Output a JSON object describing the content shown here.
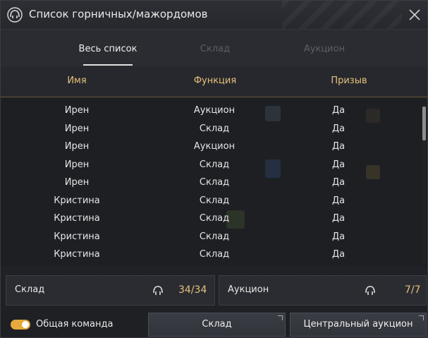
{
  "window": {
    "title": "Список горничных/мажордомов"
  },
  "tabs": [
    {
      "label": "Весь список",
      "active": true
    },
    {
      "label": "Склад",
      "active": false
    },
    {
      "label": "Аукцион",
      "active": false
    }
  ],
  "columns": {
    "name": "Имя",
    "function": "Функция",
    "summon": "Призыв"
  },
  "rows": [
    {
      "name": "Ирен",
      "function": "Аукцион",
      "summon": "Да"
    },
    {
      "name": "Ирен",
      "function": "Склад",
      "summon": "Да"
    },
    {
      "name": "Ирен",
      "function": "Аукцион",
      "summon": "Да"
    },
    {
      "name": "Ирен",
      "function": "Склад",
      "summon": "Да"
    },
    {
      "name": "Ирен",
      "function": "Склад",
      "summon": "Да"
    },
    {
      "name": "Кристина",
      "function": "Склад",
      "summon": "Да"
    },
    {
      "name": "Кристина",
      "function": "Склад",
      "summon": "Да"
    },
    {
      "name": "Кристина",
      "function": "Склад",
      "summon": "Да"
    },
    {
      "name": "Кристина",
      "function": "Склад",
      "summon": "Да"
    }
  ],
  "summary": {
    "storage": {
      "label": "Склад",
      "value": "34/34"
    },
    "auction": {
      "label": "Аукцион",
      "value": "7/7"
    }
  },
  "footer": {
    "shared_toggle_label": "Общая команда",
    "shared_toggle_on": true,
    "storage_button": "Склад",
    "central_auction_button": "Центральный аукцион"
  },
  "colors": {
    "accent_gold": "#e5c17a",
    "toggle_on": "#e5a93d"
  },
  "icons": {
    "title": "maid-icon",
    "close": "close-icon",
    "panel": "maid-icon"
  }
}
